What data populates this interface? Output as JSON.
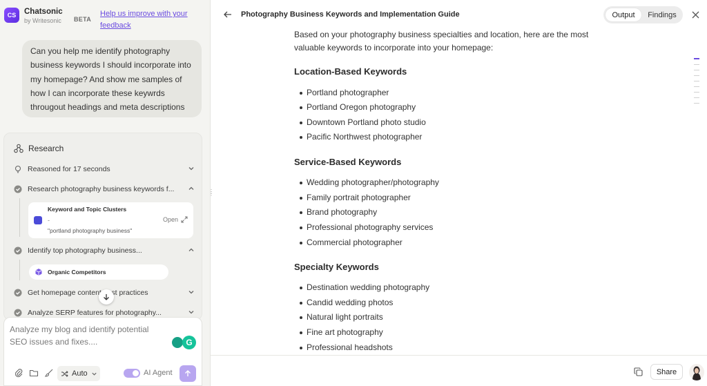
{
  "app": {
    "logo_text": "CS",
    "name": "Chatsonic",
    "byline": "by Writesonic",
    "beta": "BETA",
    "feedback_link": "Help us improve with your feedback"
  },
  "chat": {
    "user_message": "Can you help me identify photography business keywords I should incorporate into my homepage? And show me samples of how I can incorporate these keywrds througout headings and meta descriptions"
  },
  "research": {
    "title": "Research",
    "steps": [
      {
        "label": "Reasoned for 17 seconds",
        "state": "collapsed"
      },
      {
        "label": "Research photography business keywords f...",
        "state": "expanded"
      },
      {
        "label": "Identify top photography business...",
        "state": "expanded"
      },
      {
        "label": "Get homepage content best practices",
        "state": "collapsed"
      },
      {
        "label": "Analyze SERP features for photography...",
        "state": "collapsed"
      }
    ],
    "tool_card": {
      "title": "Keyword and Topic Clusters",
      "dash": "-",
      "query": "\"portland photography business\"",
      "open_label": "Open"
    },
    "competitors_pill": "Organic Competitors"
  },
  "composer": {
    "placeholder": "Analyze my blog and identify potential SEO issues and fixes....",
    "mode_label": "Auto",
    "agent_label": "AI Agent",
    "grammarly_letter": "G"
  },
  "document": {
    "title": "Photography Business Keywords and Implementation Guide",
    "tabs": [
      "Output",
      "Findings"
    ],
    "active_tab": "Output",
    "intro": "Based on your photography business specialties and location, here are the most valuable keywords to incorporate into your homepage:",
    "sections": [
      {
        "heading": "Location-Based Keywords",
        "items": [
          "Portland photographer",
          "Portland Oregon photography",
          "Downtown Portland photo studio",
          "Pacific Northwest photographer"
        ]
      },
      {
        "heading": "Service-Based Keywords",
        "items": [
          "Wedding photographer/photography",
          "Family portrait photographer",
          "Brand photography",
          "Professional photography services",
          "Commercial photographer"
        ]
      },
      {
        "heading": "Specialty Keywords",
        "items": [
          "Destination wedding photography",
          "Candid wedding photos",
          "Natural light portraits",
          "Fine art photography",
          "Professional headshots"
        ]
      }
    ],
    "share_label": "Share"
  },
  "colors": {
    "accent": "#6a4be0",
    "panel_bg": "#f4f4f1",
    "grammarly": "#15c39a"
  }
}
